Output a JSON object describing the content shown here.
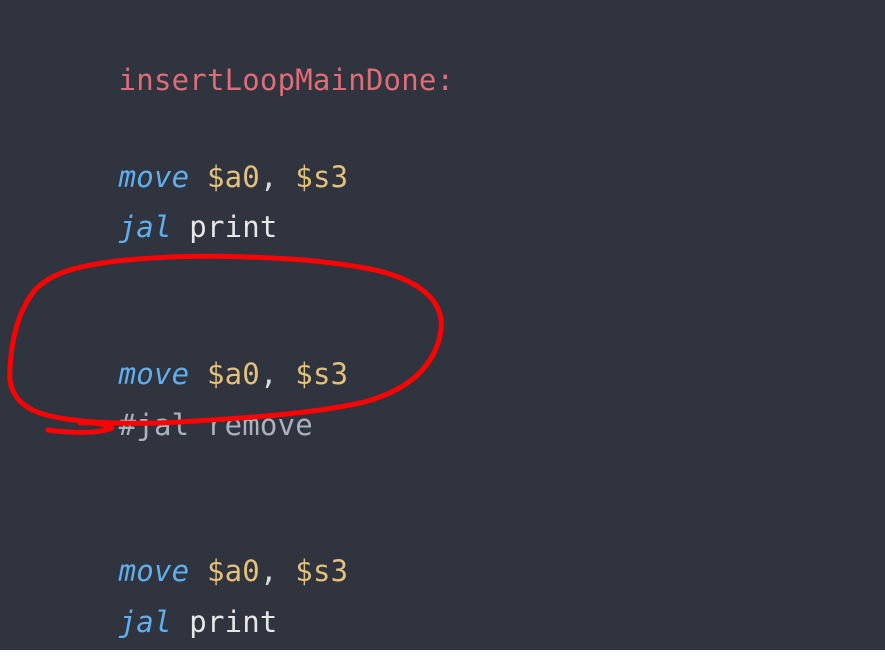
{
  "editor": {
    "colors": {
      "background": "#2f343f",
      "label": "#e06c75",
      "keyword": "#61afef",
      "register": "#e5c07b",
      "text": "#e6e6e6",
      "comment": "#aab2bf",
      "annotation": "#ff0000"
    },
    "lines": [
      {
        "label": "insertLoopMainDone:"
      },
      {
        "instr": "move",
        "arg1": "$a0",
        "sep": ",",
        "arg2": "$s3"
      },
      {
        "instr": "jal",
        "target": "print"
      },
      {
        "instr": "move",
        "arg1": "$a0",
        "sep": ",",
        "arg2": "$s3"
      },
      {
        "comment": "#jal remove"
      },
      {
        "instr": "move",
        "arg1": "$a0",
        "sep": ",",
        "arg2": "$s3"
      },
      {
        "instr": "jal",
        "target": "print"
      }
    ]
  },
  "annotation": {
    "shape": "hand-drawn-circle",
    "color": "#ff0000"
  }
}
